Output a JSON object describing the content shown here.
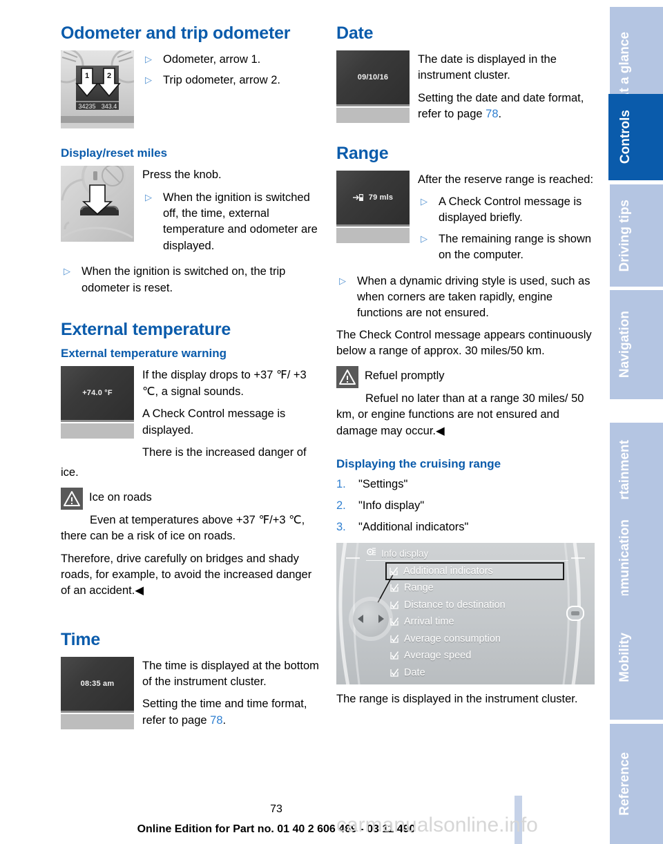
{
  "document": {
    "page_number": "73",
    "footer": "Online Edition for Part no. 01 40 2 606 469 - 03 11 490",
    "watermark": "carmanualsonline.info"
  },
  "tabs": [
    {
      "label": "At a glance",
      "active": false
    },
    {
      "label": "Controls",
      "active": true
    },
    {
      "label": "Driving tips",
      "active": false
    },
    {
      "label": "Navigation",
      "active": false
    },
    {
      "label": "Entertainment",
      "active": false
    },
    {
      "label": "Communication",
      "active": false
    },
    {
      "label": "Mobility",
      "active": false
    },
    {
      "label": "Reference",
      "active": false
    }
  ],
  "colors": {
    "heading_blue": "#0a5bab",
    "link_blue": "#2f7fd0",
    "tab_inactive": "#b4c5e2",
    "tab_active": "#0a5bab",
    "warning_icon_bg": "#595959"
  },
  "left_column": {
    "odometer": {
      "title": "Odometer and trip odometer",
      "figure": {
        "name": "odometer-photo",
        "odometer_value": "34235",
        "trip_value": "343.4",
        "arrow_labels": [
          "1",
          "2"
        ]
      },
      "bullets": [
        "Odometer, arrow 1.",
        "Trip odometer, arrow 2."
      ]
    },
    "display_reset": {
      "title": "Display/reset miles",
      "figure": {
        "name": "knob-photo"
      },
      "intro": "Press the knob.",
      "bullets_indented": [
        "When the ignition is switched off, the time, external temperature and odometer are displayed."
      ],
      "bullets": [
        "When the ignition is switched on, the trip odometer is reset."
      ]
    },
    "external_temperature": {
      "title": "External temperature",
      "subtitle": "External temperature warning",
      "figure": {
        "name": "temperature-cluster",
        "value": "+74.0 °F"
      },
      "paragraphs": [
        "If the display drops to +37 ℉/ +3 ℃, a signal sounds.",
        "A Check Control message is displayed.",
        "There is the increased danger of"
      ],
      "continuation": "ice.",
      "warning": {
        "title": "Ice on roads",
        "body": "Even at temperatures above +37 ℉/+3 ℃, there can be a risk of ice on roads.",
        "body2": "Therefore, drive carefully on bridges and shady roads, for example, to avoid the increased danger of an accident.◀"
      }
    },
    "time": {
      "title": "Time",
      "figure": {
        "name": "time-cluster",
        "value": "08:35 am"
      },
      "paragraph1": "The time is displayed at the bottom of the instrument cluster.",
      "paragraph2_pre": "Setting the time and time format, refer to page ",
      "paragraph2_link": "78",
      "paragraph2_post": "."
    }
  },
  "right_column": {
    "date": {
      "title": "Date",
      "figure": {
        "name": "date-cluster",
        "value": "09/10/16"
      },
      "paragraph1": "The date is displayed in the instrument cluster.",
      "paragraph2_pre": "Setting the date and date format, refer to page ",
      "paragraph2_link": "78",
      "paragraph2_post": "."
    },
    "range": {
      "title": "Range",
      "figure": {
        "name": "range-cluster",
        "value": "79 mls",
        "icon": "fuel-pump-icon"
      },
      "intro": "After the reserve range is reached:",
      "bullets_indented": [
        "A Check Control message is displayed briefly.",
        "The remaining range is shown on the computer."
      ],
      "bullets": [
        "When a dynamic driving style is used, such as when corners are taken rapidly, engine functions are not ensured."
      ],
      "paragraph": "The Check Control message appears continuously below a range of approx. 30 miles/50 km.",
      "warning": {
        "title": "Refuel promptly",
        "body": "Refuel no later than at a range 30 miles/ 50 km, or engine functions are not ensured and damage may occur.◀"
      }
    },
    "cruising_range": {
      "title": "Displaying the cruising range",
      "steps": [
        {
          "num": "1.",
          "text": "\"Settings\""
        },
        {
          "num": "2.",
          "text": "\"Info display\""
        },
        {
          "num": "3.",
          "text": "\"Additional indicators\""
        }
      ],
      "idrive": {
        "header": "Info display",
        "header_icon": "settings-gear-icon",
        "items": [
          {
            "label": "Additional indicators",
            "checked": true,
            "selected": true
          },
          {
            "label": "Range",
            "checked": true,
            "selected": false
          },
          {
            "label": "Distance to destination",
            "checked": true,
            "selected": false
          },
          {
            "label": "Arrival time",
            "checked": true,
            "selected": false
          },
          {
            "label": "Average consumption",
            "checked": true,
            "selected": false
          },
          {
            "label": "Average speed",
            "checked": true,
            "selected": false
          },
          {
            "label": "Date",
            "checked": true,
            "selected": false
          }
        ]
      },
      "caption": "The range is displayed in the instrument cluster."
    }
  }
}
